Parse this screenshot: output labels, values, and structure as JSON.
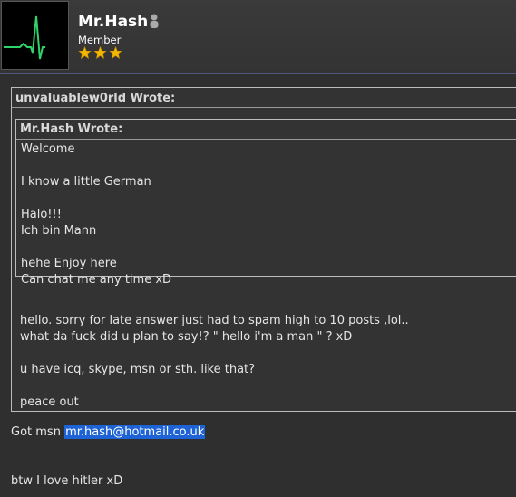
{
  "user": {
    "name": "Mr.Hash",
    "rank": "Member",
    "stars": 3
  },
  "outer_quote": {
    "title": "unvaluablew0rld Wrote:",
    "inner_quote": {
      "title": "Mr.Hash Wrote:",
      "lines": [
        "Welcome",
        "",
        "I know a little German",
        "",
        "Halo!!!",
        "Ich bin Mann",
        "",
        "hehe Enjoy here",
        "Can chat me any time xD"
      ]
    },
    "lines": [
      "hello. sorry for late answer just had to spam high to 10 posts ,lol..",
      "what da fuck did u plan to say!? \" hello i'm a man \" ? xD",
      "",
      "u have icq, skype, msn or sth. like that?",
      "",
      "peace out"
    ]
  },
  "reply": {
    "msn_prefix": "Got msn",
    "email": "mr.hash@hotmail.co.uk",
    "last_line": "btw I love hitler xD"
  },
  "colors": {
    "background": "#2f2f2f",
    "email_highlight": "#1e63d6",
    "star": "#f5b800",
    "heartbeat": "#2fd36a"
  }
}
